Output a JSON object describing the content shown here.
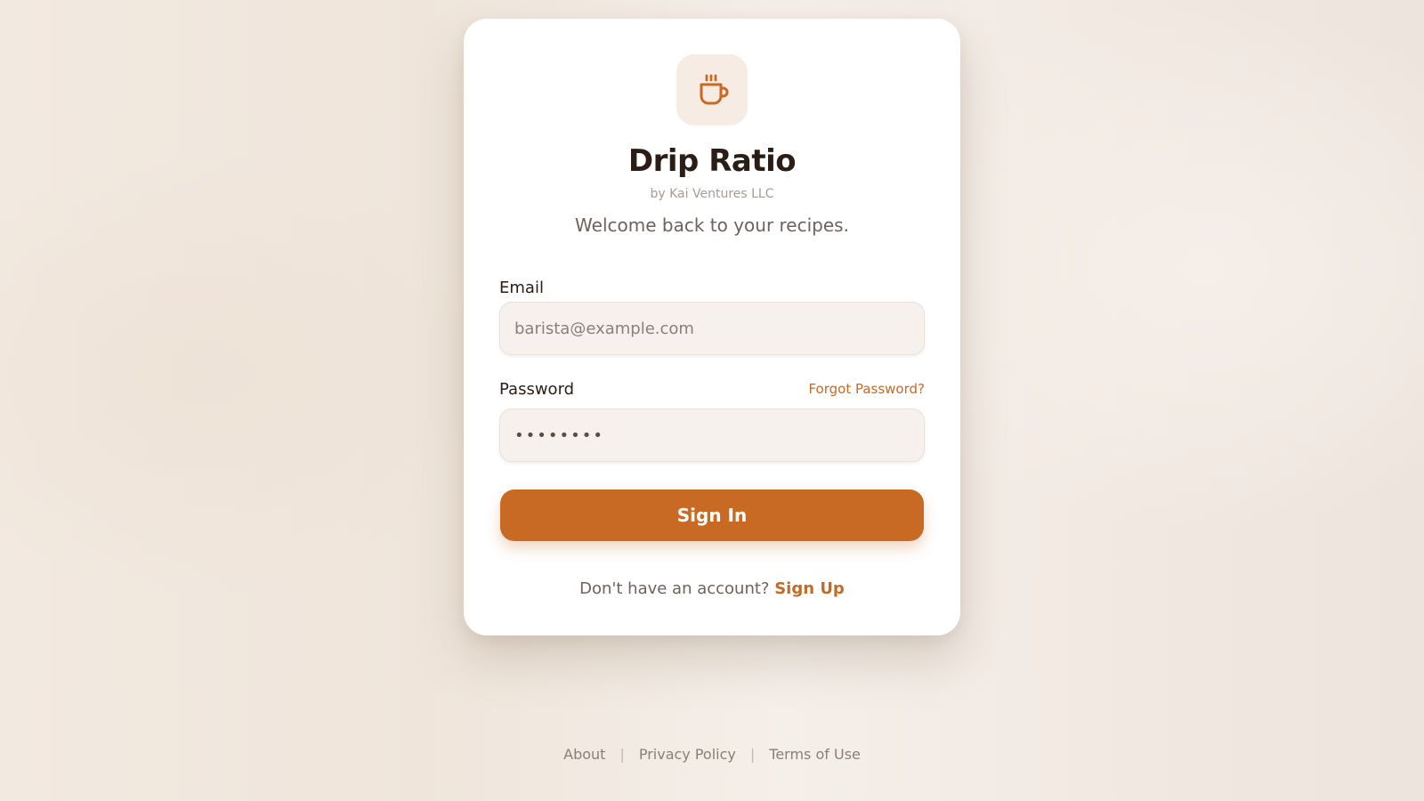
{
  "app": {
    "title": "Drip Ratio",
    "byline": "by Kai Ventures LLC",
    "welcome": "Welcome back to your recipes.",
    "logo_icon": "coffee-cup-icon"
  },
  "form": {
    "email_label": "Email",
    "email_placeholder": "barista@example.com",
    "email_value": "",
    "password_label": "Password",
    "password_value": "••••••••",
    "forgot_label": "Forgot Password?",
    "signin_label": "Sign In",
    "signup_prompt": "Don't have an account?",
    "signup_label": "Sign Up"
  },
  "footer": {
    "links": [
      "About",
      "Privacy Policy",
      "Terms of Use"
    ],
    "separator": "|"
  },
  "colors": {
    "accent": "#c96a24",
    "link": "#c46a28",
    "title": "#2a1d15",
    "logo_tile": "#f7ece4"
  }
}
